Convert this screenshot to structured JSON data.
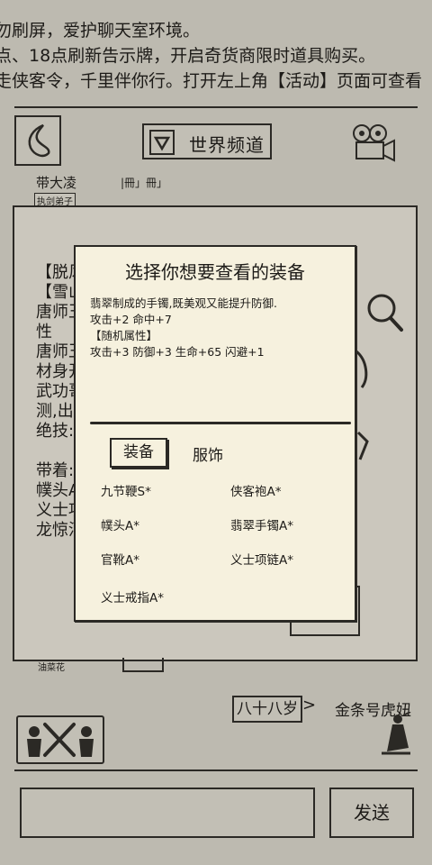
{
  "notices": [
    "勿刷屏，爱护聊天室环境。",
    "点、18点刷新告示牌，开启奇货商限时道具购买。",
    "走侠客令，千里伴你行。打开左上角【活动】页面可查看"
  ],
  "header": {
    "channel_label": "世界频道"
  },
  "chat": {
    "sender_name": "带大凌",
    "sender_tag": "执剑弟子",
    "bracket_text": "|冊」冊」",
    "card_lines": [
      "【脱风",
      "【雪山",
      "唐师王",
      "性",
      "唐师王",
      "材身开",
      "武功哥",
      "测,出手",
      "绝技:",
      "",
      "带着:",
      "幞头A",
      "义士项",
      "龙惊河"
    ],
    "footer_tag": "油菜花"
  },
  "modal": {
    "title": "选择你想要查看的装备",
    "description": [
      "翡翠制成的手镯,既美观又能提升防御.",
      "攻击+2 命中+7",
      "【随机属性】",
      "攻击+3 防御+3 生命+65 闪避+1"
    ],
    "tabs": [
      "装备",
      "服饰"
    ],
    "items": [
      "九节鞭S*",
      "侠客袍A*",
      "幞头A*",
      "翡翠手镯A*",
      "官靴A*",
      "义士项链A*",
      "义士戒指A*"
    ]
  },
  "bottom": {
    "age_label": "八十八岁",
    "speaker_name": "金条号虎妞",
    "send_label": "发送",
    "input_value": ""
  }
}
